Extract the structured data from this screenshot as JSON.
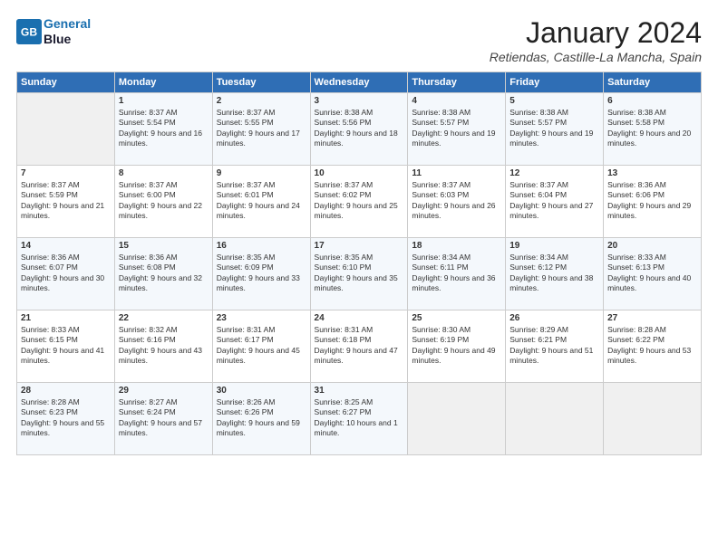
{
  "header": {
    "logo_line1": "General",
    "logo_line2": "Blue",
    "month_title": "January 2024",
    "location": "Retiendas, Castille-La Mancha, Spain"
  },
  "days_of_week": [
    "Sunday",
    "Monday",
    "Tuesday",
    "Wednesday",
    "Thursday",
    "Friday",
    "Saturday"
  ],
  "weeks": [
    [
      {
        "day": "",
        "sunrise": "",
        "sunset": "",
        "daylight": ""
      },
      {
        "day": "1",
        "sunrise": "Sunrise: 8:37 AM",
        "sunset": "Sunset: 5:54 PM",
        "daylight": "Daylight: 9 hours and 16 minutes."
      },
      {
        "day": "2",
        "sunrise": "Sunrise: 8:37 AM",
        "sunset": "Sunset: 5:55 PM",
        "daylight": "Daylight: 9 hours and 17 minutes."
      },
      {
        "day": "3",
        "sunrise": "Sunrise: 8:38 AM",
        "sunset": "Sunset: 5:56 PM",
        "daylight": "Daylight: 9 hours and 18 minutes."
      },
      {
        "day": "4",
        "sunrise": "Sunrise: 8:38 AM",
        "sunset": "Sunset: 5:57 PM",
        "daylight": "Daylight: 9 hours and 19 minutes."
      },
      {
        "day": "5",
        "sunrise": "Sunrise: 8:38 AM",
        "sunset": "Sunset: 5:57 PM",
        "daylight": "Daylight: 9 hours and 19 minutes."
      },
      {
        "day": "6",
        "sunrise": "Sunrise: 8:38 AM",
        "sunset": "Sunset: 5:58 PM",
        "daylight": "Daylight: 9 hours and 20 minutes."
      }
    ],
    [
      {
        "day": "7",
        "sunrise": "Sunrise: 8:37 AM",
        "sunset": "Sunset: 5:59 PM",
        "daylight": "Daylight: 9 hours and 21 minutes."
      },
      {
        "day": "8",
        "sunrise": "Sunrise: 8:37 AM",
        "sunset": "Sunset: 6:00 PM",
        "daylight": "Daylight: 9 hours and 22 minutes."
      },
      {
        "day": "9",
        "sunrise": "Sunrise: 8:37 AM",
        "sunset": "Sunset: 6:01 PM",
        "daylight": "Daylight: 9 hours and 24 minutes."
      },
      {
        "day": "10",
        "sunrise": "Sunrise: 8:37 AM",
        "sunset": "Sunset: 6:02 PM",
        "daylight": "Daylight: 9 hours and 25 minutes."
      },
      {
        "day": "11",
        "sunrise": "Sunrise: 8:37 AM",
        "sunset": "Sunset: 6:03 PM",
        "daylight": "Daylight: 9 hours and 26 minutes."
      },
      {
        "day": "12",
        "sunrise": "Sunrise: 8:37 AM",
        "sunset": "Sunset: 6:04 PM",
        "daylight": "Daylight: 9 hours and 27 minutes."
      },
      {
        "day": "13",
        "sunrise": "Sunrise: 8:36 AM",
        "sunset": "Sunset: 6:06 PM",
        "daylight": "Daylight: 9 hours and 29 minutes."
      }
    ],
    [
      {
        "day": "14",
        "sunrise": "Sunrise: 8:36 AM",
        "sunset": "Sunset: 6:07 PM",
        "daylight": "Daylight: 9 hours and 30 minutes."
      },
      {
        "day": "15",
        "sunrise": "Sunrise: 8:36 AM",
        "sunset": "Sunset: 6:08 PM",
        "daylight": "Daylight: 9 hours and 32 minutes."
      },
      {
        "day": "16",
        "sunrise": "Sunrise: 8:35 AM",
        "sunset": "Sunset: 6:09 PM",
        "daylight": "Daylight: 9 hours and 33 minutes."
      },
      {
        "day": "17",
        "sunrise": "Sunrise: 8:35 AM",
        "sunset": "Sunset: 6:10 PM",
        "daylight": "Daylight: 9 hours and 35 minutes."
      },
      {
        "day": "18",
        "sunrise": "Sunrise: 8:34 AM",
        "sunset": "Sunset: 6:11 PM",
        "daylight": "Daylight: 9 hours and 36 minutes."
      },
      {
        "day": "19",
        "sunrise": "Sunrise: 8:34 AM",
        "sunset": "Sunset: 6:12 PM",
        "daylight": "Daylight: 9 hours and 38 minutes."
      },
      {
        "day": "20",
        "sunrise": "Sunrise: 8:33 AM",
        "sunset": "Sunset: 6:13 PM",
        "daylight": "Daylight: 9 hours and 40 minutes."
      }
    ],
    [
      {
        "day": "21",
        "sunrise": "Sunrise: 8:33 AM",
        "sunset": "Sunset: 6:15 PM",
        "daylight": "Daylight: 9 hours and 41 minutes."
      },
      {
        "day": "22",
        "sunrise": "Sunrise: 8:32 AM",
        "sunset": "Sunset: 6:16 PM",
        "daylight": "Daylight: 9 hours and 43 minutes."
      },
      {
        "day": "23",
        "sunrise": "Sunrise: 8:31 AM",
        "sunset": "Sunset: 6:17 PM",
        "daylight": "Daylight: 9 hours and 45 minutes."
      },
      {
        "day": "24",
        "sunrise": "Sunrise: 8:31 AM",
        "sunset": "Sunset: 6:18 PM",
        "daylight": "Daylight: 9 hours and 47 minutes."
      },
      {
        "day": "25",
        "sunrise": "Sunrise: 8:30 AM",
        "sunset": "Sunset: 6:19 PM",
        "daylight": "Daylight: 9 hours and 49 minutes."
      },
      {
        "day": "26",
        "sunrise": "Sunrise: 8:29 AM",
        "sunset": "Sunset: 6:21 PM",
        "daylight": "Daylight: 9 hours and 51 minutes."
      },
      {
        "day": "27",
        "sunrise": "Sunrise: 8:28 AM",
        "sunset": "Sunset: 6:22 PM",
        "daylight": "Daylight: 9 hours and 53 minutes."
      }
    ],
    [
      {
        "day": "28",
        "sunrise": "Sunrise: 8:28 AM",
        "sunset": "Sunset: 6:23 PM",
        "daylight": "Daylight: 9 hours and 55 minutes."
      },
      {
        "day": "29",
        "sunrise": "Sunrise: 8:27 AM",
        "sunset": "Sunset: 6:24 PM",
        "daylight": "Daylight: 9 hours and 57 minutes."
      },
      {
        "day": "30",
        "sunrise": "Sunrise: 8:26 AM",
        "sunset": "Sunset: 6:26 PM",
        "daylight": "Daylight: 9 hours and 59 minutes."
      },
      {
        "day": "31",
        "sunrise": "Sunrise: 8:25 AM",
        "sunset": "Sunset: 6:27 PM",
        "daylight": "Daylight: 10 hours and 1 minute."
      },
      {
        "day": "",
        "sunrise": "",
        "sunset": "",
        "daylight": ""
      },
      {
        "day": "",
        "sunrise": "",
        "sunset": "",
        "daylight": ""
      },
      {
        "day": "",
        "sunrise": "",
        "sunset": "",
        "daylight": ""
      }
    ]
  ]
}
